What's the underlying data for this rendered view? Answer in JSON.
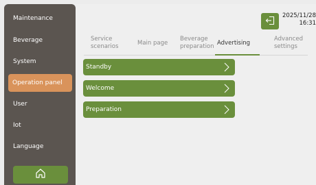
{
  "sidebar": {
    "items": [
      {
        "label": "Maintenance"
      },
      {
        "label": "Beverage"
      },
      {
        "label": "System"
      },
      {
        "label": "Operation panel"
      },
      {
        "label": "User"
      },
      {
        "label": "Iot"
      },
      {
        "label": "Language"
      }
    ],
    "active_index": 3,
    "home_icon": "home-icon"
  },
  "header": {
    "exit_icon": "exit-icon",
    "date": "2025/11/28",
    "time": "16:31"
  },
  "tabs": [
    {
      "line1": "Service",
      "line2": "scenarios"
    },
    {
      "line1": "Main page",
      "line2": ""
    },
    {
      "line1": "Beverage",
      "line2": "preparation"
    },
    {
      "line1": "Advertising",
      "line2": ""
    },
    {
      "line1": "Advanced",
      "line2": "settings"
    }
  ],
  "active_tab": "Advertising",
  "list": [
    {
      "label": "Standby"
    },
    {
      "label": "Welcome"
    },
    {
      "label": "Preparation"
    }
  ],
  "colors": {
    "accent_green": "#6a8f3c",
    "active_orange": "#d9935b",
    "sidebar_bg": "#5b5550"
  }
}
